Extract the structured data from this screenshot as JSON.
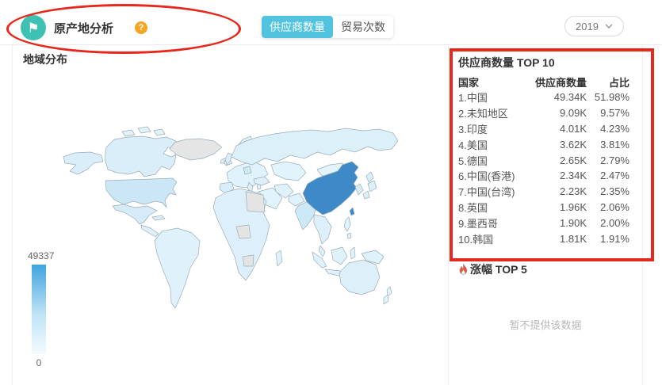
{
  "header": {
    "title": "原产地分析",
    "help": "?",
    "tabs": [
      {
        "label": "供应商数量",
        "active": true
      },
      {
        "label": "贸易次数",
        "active": false
      }
    ],
    "year_dropdown": {
      "value": "2019"
    }
  },
  "map_panel": {
    "title": "地域分布",
    "legend": {
      "max": "49337",
      "min": "0"
    },
    "highlight_country": "中国"
  },
  "top10": {
    "title": "供应商数量 TOP 10",
    "columns": [
      "国家",
      "供应商数量",
      "占比"
    ],
    "rows": [
      {
        "label": "1.中国",
        "count": "49.34K",
        "share": "51.98%"
      },
      {
        "label": "2.未知地区",
        "count": "9.09K",
        "share": "9.57%"
      },
      {
        "label": "3.印度",
        "count": "4.01K",
        "share": "4.23%"
      },
      {
        "label": "4.美国",
        "count": "3.62K",
        "share": "3.81%"
      },
      {
        "label": "5.德国",
        "count": "2.65K",
        "share": "2.79%"
      },
      {
        "label": "6.中国(香港)",
        "count": "2.34K",
        "share": "2.47%"
      },
      {
        "label": "7.中国(台湾)",
        "count": "2.23K",
        "share": "2.35%"
      },
      {
        "label": "8.英国",
        "count": "1.96K",
        "share": "2.06%"
      },
      {
        "label": "9.墨西哥",
        "count": "1.90K",
        "share": "2.00%"
      },
      {
        "label": "10.韩国",
        "count": "1.81K",
        "share": "1.91%"
      }
    ]
  },
  "rise_top5": {
    "title": "涨幅 TOP 5",
    "empty_text": "暂不提供该数据"
  },
  "chart_data": {
    "type": "heatmap",
    "subtype": "choropleth-world-map",
    "title": "地域分布",
    "value_range": [
      0,
      49337
    ],
    "legend_position": "bottom-left",
    "series": [
      {
        "name": "中国",
        "value": 49337,
        "share": "51.98%"
      },
      {
        "name": "未知地区",
        "value": 9090,
        "share": "9.57%"
      },
      {
        "name": "印度",
        "value": 4010,
        "share": "4.23%"
      },
      {
        "name": "美国",
        "value": 3620,
        "share": "3.81%"
      },
      {
        "name": "德国",
        "value": 2650,
        "share": "2.79%"
      },
      {
        "name": "中国(香港)",
        "value": 2340,
        "share": "2.47%"
      },
      {
        "name": "中国(台湾)",
        "value": 2230,
        "share": "2.35%"
      },
      {
        "name": "英国",
        "value": 1960,
        "share": "2.06%"
      },
      {
        "name": "墨西哥",
        "value": 1900,
        "share": "2.00%"
      },
      {
        "name": "韩国",
        "value": 1810,
        "share": "1.91%"
      }
    ]
  },
  "colors": {
    "accent_teal": "#3ec1b3",
    "tab_active": "#52c3de",
    "help_orange": "#f5a623",
    "annotation_red": "#e5281b",
    "china_blue": "#3e8ac9",
    "legend_top": "#3fa3df",
    "flame_orange": "#f4502c"
  }
}
